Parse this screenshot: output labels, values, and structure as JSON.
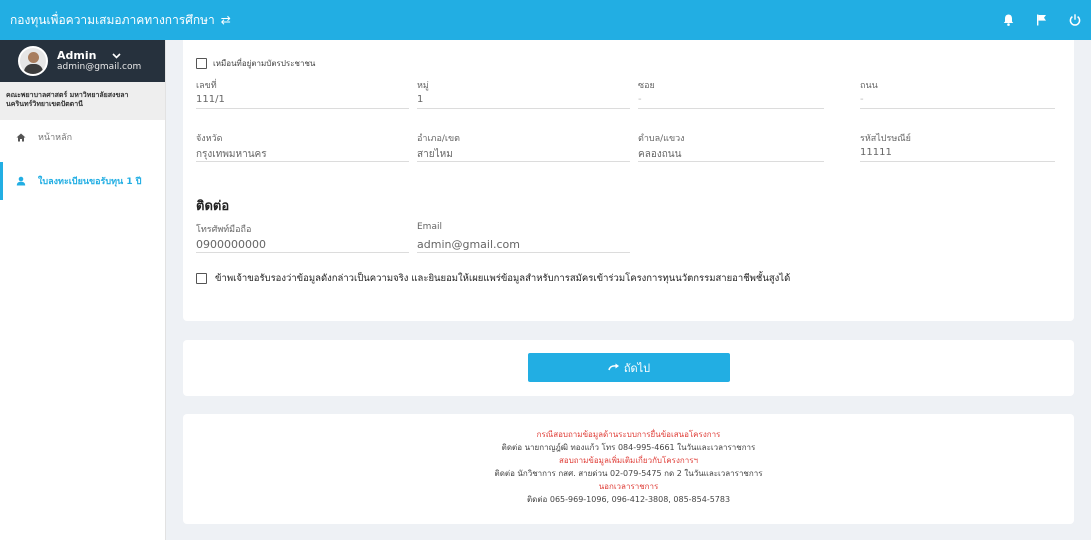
{
  "app": {
    "title": "กองทุนเพื่อความเสมอภาคทางการศึกษา",
    "swap_icon": "swap-arrows-icon"
  },
  "topbar": {
    "icons": [
      "bell-icon",
      "flag-icon",
      "power-icon"
    ]
  },
  "profile": {
    "name": "Admin",
    "email": "admin@gmail.com"
  },
  "sidebar": {
    "org_line1": "คณะพยาบาลศาสตร์ มหาวิทยาลัยสงขลา",
    "org_line2": "นครินทร์วิทยาเขตปัตตานี",
    "items": [
      {
        "label": "หน้าหลัก",
        "icon": "home-icon",
        "active": false
      },
      {
        "label": "ใบลงทะเบียนขอรับทุน 1 ปี",
        "icon": "user-icon",
        "active": true
      }
    ]
  },
  "address": {
    "same_as_id_label": "เหมือนที่อยู่ตามบัตรประชาชน",
    "row1": [
      {
        "label": "เลขที่",
        "value": "111/1"
      },
      {
        "label": "หมู่",
        "value": "1"
      },
      {
        "label": "ซอย",
        "value": "-"
      },
      {
        "label": "ถนน",
        "value": "-"
      }
    ],
    "row2": [
      {
        "label": "จังหวัด",
        "value": "กรุงเทพมหานคร"
      },
      {
        "label": "อำเภอ/เขต",
        "value": "สายไหม"
      },
      {
        "label": "ตำบล/แขวง",
        "value": "คลองถนน"
      },
      {
        "label": "รหัสไปรษณีย์",
        "value": "11111"
      }
    ]
  },
  "contact": {
    "title": "ติดต่อ",
    "phone_label": "โทรศัพท์มือถือ",
    "phone_value": "0900000000",
    "email_label": "Email",
    "email_value": "admin@gmail.com"
  },
  "consent": {
    "text": "ข้าพเจ้าขอรับรองว่าข้อมูลดังกล่าวเป็นความจริง และยินยอมให้เผยแพร่ข้อมูลสำหรับการสมัครเข้าร่วมโครงการทุนนวัตกรรมสายอาชีพชั้นสูงได้"
  },
  "next": {
    "label": "ถัดไป",
    "icon": "arrow-forward-icon"
  },
  "footer": {
    "line1": "กรณีสอบถามข้อมูลด้านระบบการยื่นข้อเสนอโครงการ",
    "line2": "ติดต่อ นายกาญฎ์ฒิ ทองแก้ว โทร 084-995-4661 ในวันและเวลาราชการ",
    "line3": "สอบถามข้อมูลเพิ่มเติมเกี่ยวกับโครงการฯ",
    "line4": "ติดต่อ นักวิชาการ กสศ. สายด่วน 02-079-5475 กด 2 ในวันและเวลาราชการ",
    "line5": "นอกเวลาราชการ",
    "line6": "ติดต่อ 065-969-1096, 096-412-3808, 085-854-5783"
  }
}
